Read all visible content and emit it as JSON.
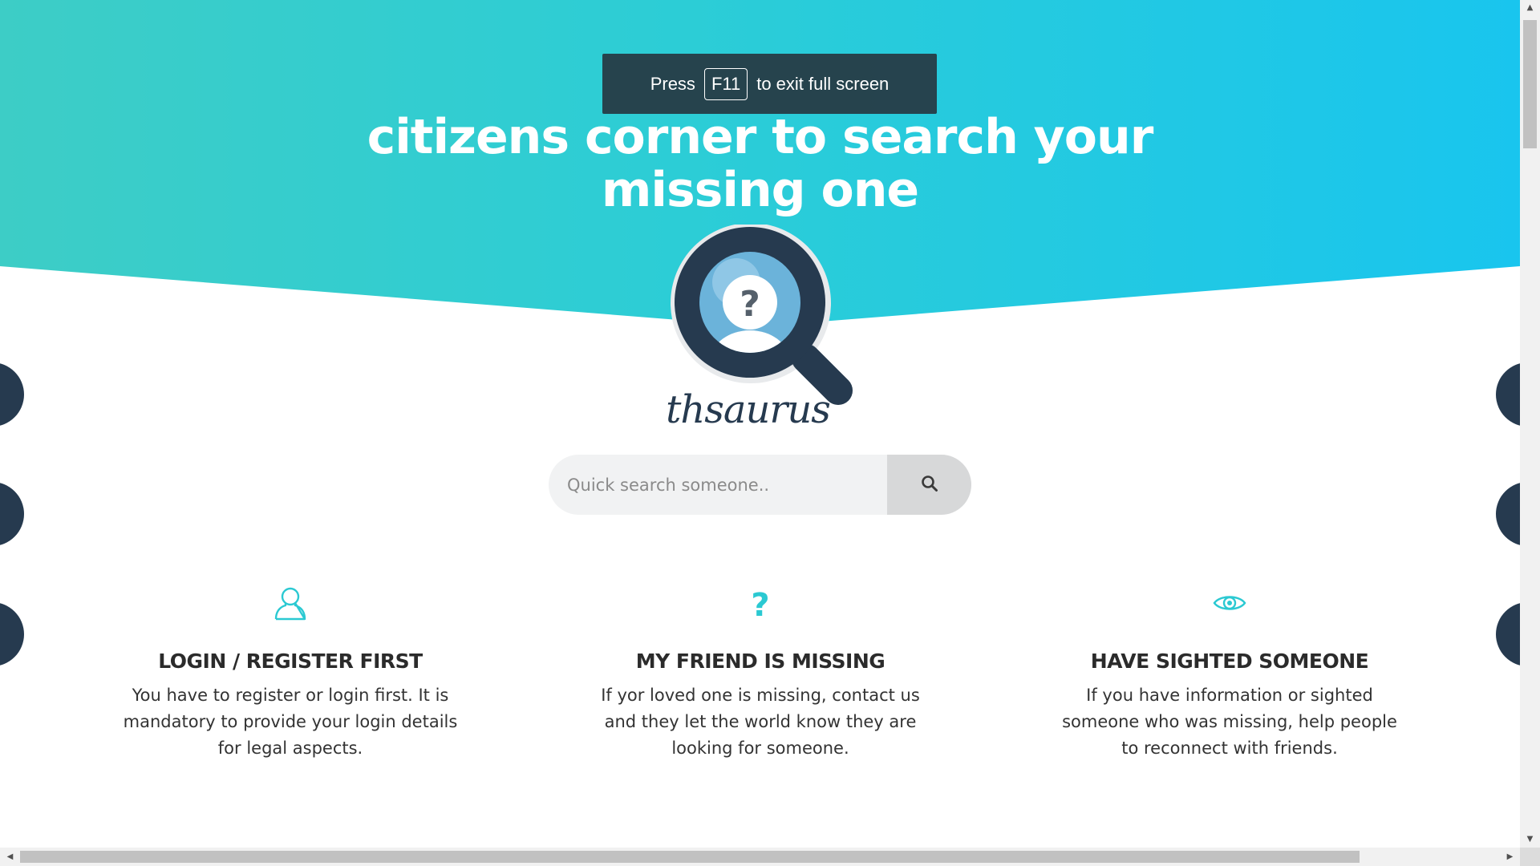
{
  "toast": {
    "prefix": "Press",
    "key": "F11",
    "suffix": "to exit full screen"
  },
  "hero": {
    "title_line1": "citizens corner to search your",
    "title_line2": "missing one"
  },
  "logo": {
    "icon": "magnifier-missing-person-icon",
    "brand": "thsaurus"
  },
  "search": {
    "placeholder": "Quick search someone..",
    "button_icon": "search-icon"
  },
  "features": [
    {
      "icon": "user-icon",
      "title": "LOGIN / REGISTER FIRST",
      "text": "You have to register or login first. It is mandatory to provide your login details for legal aspects."
    },
    {
      "icon": "question-icon",
      "title": "MY FRIEND IS MISSING",
      "text": "If yor loved one is missing, contact us and they let the world know they are looking for someone."
    },
    {
      "icon": "eye-icon",
      "title": "HAVE SIGHTED SOMEONE",
      "text": "If you have information or sighted someone who was missing, help people to reconnect with friends."
    }
  ],
  "colors": {
    "accent": "#2bc9d2",
    "navy": "#263a4f",
    "gradient_start": "#3dcdc6",
    "gradient_end": "#19c5ee"
  }
}
